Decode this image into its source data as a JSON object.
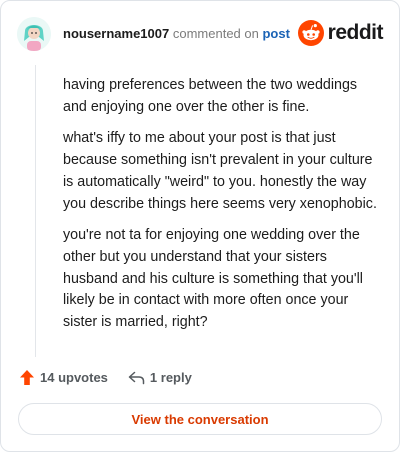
{
  "comment": {
    "username": "nousername1007",
    "action_text": "commented on",
    "post_link": "post",
    "paragraphs": [
      "having preferences between the two weddings and enjoying one over the other is fine.",
      "what's iffy to me about your post is that just because something isn't prevalent in your culture is automatically \"weird\" to you. honestly the way you describe things here seems very xenophobic.",
      "you're not ta for enjoying one wedding over the other but you understand that your sisters husband and his culture is something that you'll likely be in contact with more often once your sister is married, right?"
    ]
  },
  "brand": {
    "name": "reddit",
    "icon": "reddit-logo-icon",
    "color": "#ff4500"
  },
  "actions": {
    "upvotes": "14 upvotes",
    "upvote_icon": "upvote-arrow-icon",
    "replies": "1 reply",
    "reply_icon": "reply-icon"
  },
  "cta": {
    "label": "View the conversation",
    "color": "#d93a00"
  }
}
